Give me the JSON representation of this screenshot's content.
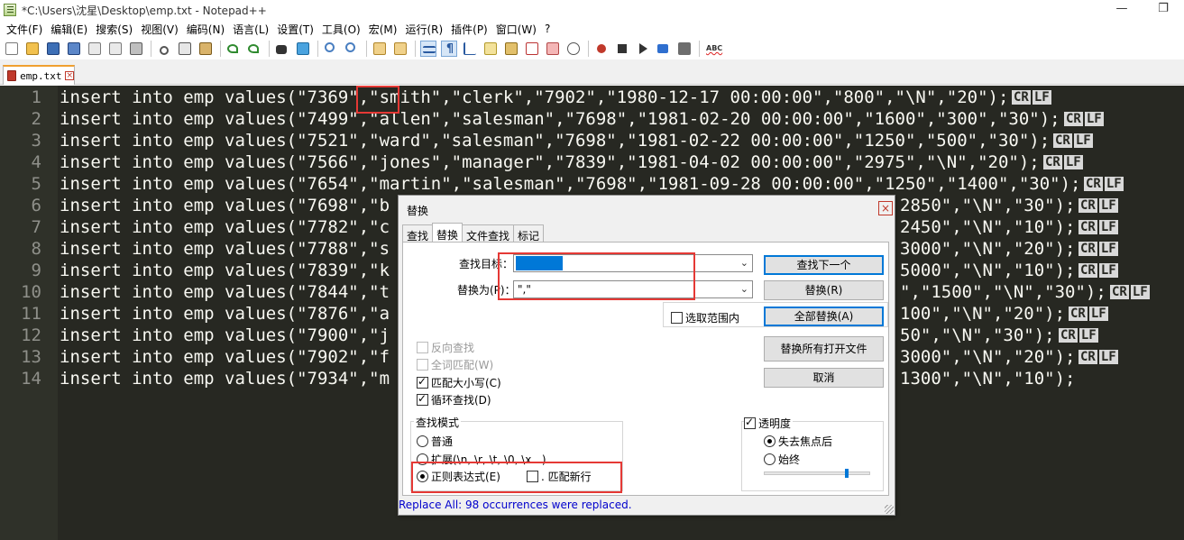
{
  "window": {
    "title": "*C:\\Users\\沈星\\Desktop\\emp.txt - Notepad++",
    "minimize_glyph": "—",
    "maximize_glyph": "❐"
  },
  "menu": [
    "文件(F)",
    "编辑(E)",
    "搜索(S)",
    "视图(V)",
    "编码(N)",
    "语言(L)",
    "设置(T)",
    "工具(O)",
    "宏(M)",
    "运行(R)",
    "插件(P)",
    "窗口(W)",
    "?"
  ],
  "toolbar": {
    "allchars_glyph": "¶",
    "spell_label": "ABC"
  },
  "tab": {
    "label": "emp.txt",
    "close_glyph": "×"
  },
  "editor": {
    "eol_cr": "CR",
    "eol_lf": "LF",
    "lines": [
      {
        "num": "1",
        "text": "insert into emp values(\"7369\",\"smith\",\"clerk\",\"7902\",\"1980-12-17 00:00:00\",\"800\",\"\\N\",\"20\");",
        "eol": true
      },
      {
        "num": "2",
        "text": "insert into emp values(\"7499\",\"allen\",\"salesman\",\"7698\",\"1981-02-20 00:00:00\",\"1600\",\"300\",\"30\");",
        "eol": true
      },
      {
        "num": "3",
        "text": "insert into emp values(\"7521\",\"ward\",\"salesman\",\"7698\",\"1981-02-22 00:00:00\",\"1250\",\"500\",\"30\");",
        "eol": true
      },
      {
        "num": "4",
        "text": "insert into emp values(\"7566\",\"jones\",\"manager\",\"7839\",\"1981-04-02 00:00:00\",\"2975\",\"\\N\",\"20\");",
        "eol": true
      },
      {
        "num": "5",
        "text": "insert into emp values(\"7654\",\"martin\",\"salesman\",\"7698\",\"1981-09-28 00:00:00\",\"1250\",\"1400\",\"30\");",
        "eol": true
      },
      {
        "num": "6",
        "text": "insert into emp values(\"7698\",\"b",
        "tail": "2850\",\"\\N\",\"30\");",
        "eol": true
      },
      {
        "num": "7",
        "text": "insert into emp values(\"7782\",\"c",
        "tail": "2450\",\"\\N\",\"10\");",
        "eol": true
      },
      {
        "num": "8",
        "text": "insert into emp values(\"7788\",\"s",
        "tail": "3000\",\"\\N\",\"20\");",
        "eol": true
      },
      {
        "num": "9",
        "text": "insert into emp values(\"7839\",\"k",
        "tail": "5000\",\"\\N\",\"10\");",
        "eol": true
      },
      {
        "num": "10",
        "text": "insert into emp values(\"7844\",\"t",
        "tail": "\",\"1500\",\"\\N\",\"30\");",
        "eol": true
      },
      {
        "num": "11",
        "text": "insert into emp values(\"7876\",\"a",
        "tail": "100\",\"\\N\",\"20\");",
        "eol": true
      },
      {
        "num": "12",
        "text": "insert into emp values(\"7900\",\"j",
        "tail": "50\",\"\\N\",\"30\");",
        "eol": true
      },
      {
        "num": "13",
        "text": "insert into emp values(\"7902\",\"f",
        "tail": "3000\",\"\\N\",\"20\");",
        "eol": true
      },
      {
        "num": "14",
        "text": "insert into emp values(\"7934\",\"m",
        "tail": "1300\",\"\\N\",\"10\");",
        "eol": false
      }
    ]
  },
  "dialog": {
    "title": "替换",
    "close_glyph": "×",
    "tabs": [
      "查找",
      "替换",
      "文件查找",
      "标记"
    ],
    "find_label": "查找目标：",
    "find_value": "",
    "replace_label": "替换为(P)：",
    "replace_value": "\",\"",
    "combo_arrow": "⌄",
    "in_selection": "选取范围内",
    "buttons": {
      "find_next": "查找下一个",
      "replace": "替换(R)",
      "replace_all": "全部替换(A)",
      "replace_all_open": "替换所有打开文件",
      "cancel": "取消"
    },
    "options": {
      "backward": "反向查找",
      "whole_word": "全词匹配(W)",
      "match_case": "匹配大小写(C)",
      "wrap": "循环查找(D)"
    },
    "search_mode": {
      "title": "查找模式",
      "normal": "普通",
      "extended": "扩展(\\n, \\r, \\t, \\0, \\x...)",
      "regex": "正则表达式(E)",
      "dot_newline": ". 匹配新行"
    },
    "transparency": {
      "title": "透明度",
      "on_lose_focus": "失去焦点后",
      "always": "始终",
      "level_percent": 78
    },
    "status": "Replace All: 98 occurrences were replaced."
  }
}
